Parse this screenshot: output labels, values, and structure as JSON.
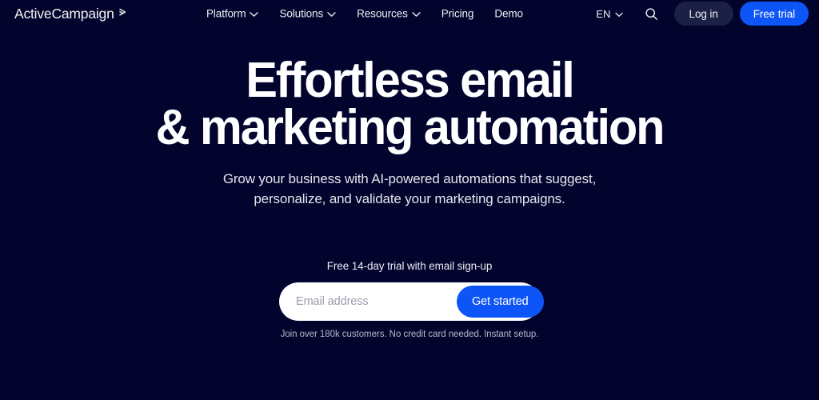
{
  "theme": {
    "background": "#02042e",
    "accent_blue": "#0d55f7",
    "login_button_bg": "#1b2045",
    "text_primary": "#ffffff",
    "text_muted": "#b9b7c8"
  },
  "header": {
    "logo_text": "ActiveCampaign",
    "logo_icon": "chevron-right-mark-icon",
    "nav": [
      {
        "label": "Platform",
        "icon": "chevron-down-icon",
        "has_dropdown": true
      },
      {
        "label": "Solutions",
        "icon": "chevron-down-icon",
        "has_dropdown": true
      },
      {
        "label": "Resources",
        "icon": "chevron-down-icon",
        "has_dropdown": true
      },
      {
        "label": "Pricing",
        "icon": "",
        "has_dropdown": false
      },
      {
        "label": "Demo",
        "icon": "",
        "has_dropdown": false
      }
    ],
    "language": {
      "label": "EN",
      "icon": "chevron-down-icon"
    },
    "search_icon": "search-icon",
    "login_label": "Log in",
    "trial_label": "Free trial"
  },
  "hero": {
    "title_line1": "Effortless email",
    "title_line2": "& marketing automation",
    "subtitle": "Grow your business with AI-powered automations that suggest, personalize, and validate your marketing campaigns.",
    "trial_note": "Free 14-day trial with email sign-up",
    "form": {
      "email_placeholder": "Email address",
      "email_value": "",
      "submit_label": "Get started"
    },
    "microcopy": "Join over 180k customers. No credit card needed. Instant setup."
  }
}
